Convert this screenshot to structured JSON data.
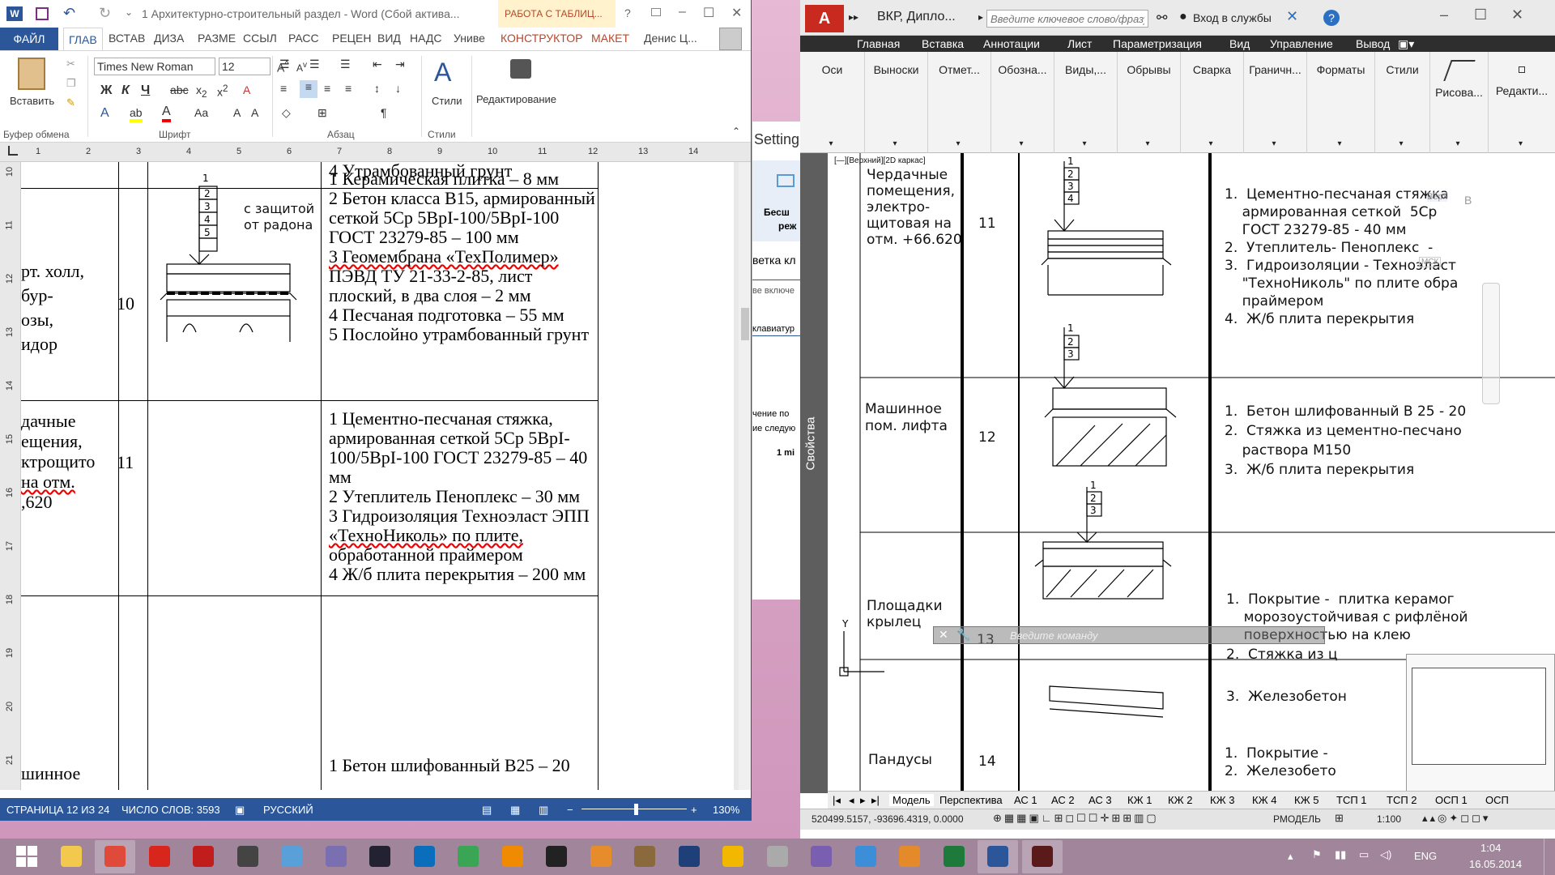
{
  "word": {
    "title": "1 Архитектурно-строительный раздел - Word (Сбой актива...",
    "context_tab": "РАБОТА С ТАБЛИЦ...",
    "window_controls": [
      "?",
      "–",
      "☐",
      "✕"
    ],
    "tabs": [
      "ФАЙЛ",
      "ГЛАВ",
      "ВСТАВ",
      "ДИЗА",
      "РАЗМЕ",
      "ССЫЛ",
      "РАСС",
      "РЕЦЕН",
      "ВИД",
      "НАДС",
      "Униве",
      "КОНСТРУКТОР",
      "МАКЕТ"
    ],
    "user": "Денис Ц...",
    "ribbon": {
      "paste": "Вставить",
      "font_name": "Times New Roman",
      "font_size": "12",
      "styles": "Стили",
      "editing": "Редактирование",
      "groups": [
        "Буфер обмена",
        "Шрифт",
        "Абзац",
        "Стили"
      ]
    },
    "ruler_numbers": [
      "1",
      "2",
      "3",
      "4",
      "5",
      "6",
      "7",
      "8",
      "9",
      "10",
      "11",
      "12",
      "13",
      "14"
    ],
    "vruler_numbers": [
      "10",
      "11",
      "12",
      "13",
      "14",
      "15",
      "16",
      "17",
      "18",
      "19",
      "20",
      "21"
    ],
    "doc": {
      "row0_text": "4 Утрамбованный грунт",
      "row1": {
        "room": [
          "рт. холл,",
          "бур-",
          "озы,",
          "идор"
        ],
        "num": "10",
        "note": [
          "с защитой",
          "от радона"
        ],
        "layers": [
          "1",
          "2",
          "3",
          "4",
          "5"
        ],
        "desc": [
          "1 Керамическая плитка – 8 мм",
          "2 Бетон класса В15, армированный",
          "сеткой 5Ср 5ВрI-100/5ВрI-100",
          "ГОСТ 23279-85 – 100 мм",
          "3 Геомембрана «ТехПолимер»",
          "ПЭВД ТУ 21-33-2-85, лист",
          "плоский, в два слоя – 2 мм",
          "4 Песчаная подготовка – 55 мм",
          "5 Послойно утрамбованный грунт"
        ]
      },
      "row2": {
        "room": [
          "дачные",
          "ещения,",
          "ктрощито",
          "на отм.",
          ",620"
        ],
        "num": "11",
        "desc": [
          "1 Цементно-песчаная стяжка,",
          "армированная сеткой 5Ср 5ВрI-",
          "100/5ВрI-100 ГОСТ 23279-85 – 40",
          "мм",
          "2 Утеплитель Пеноплекс – 30 мм",
          "3 Гидроизоляция Техноэласт ЭПП",
          "«ТехноНиколь» по плите,",
          "обработанной праймером",
          "4 Ж/б плита перекрытия – 200 мм"
        ]
      },
      "row3": {
        "room": [
          "шинное"
        ],
        "desc": [
          "1 Бетон шлифованный В25 – 20"
        ]
      }
    },
    "status": {
      "page": "СТРАНИЦА 12 ИЗ 24",
      "words": "ЧИСЛО СЛОВ: 3593",
      "lang": "РУССКИЙ",
      "zoom": "130%"
    }
  },
  "background_window": {
    "settings": "Setting",
    "items": [
      "Бесш",
      "реж",
      "ветка кл",
      "ве включе",
      "клавиатур",
      "чение по",
      "ие следую",
      "1 mi"
    ]
  },
  "autocad": {
    "title": "ВКР, Дипло...",
    "search_placeholder": "Введите ключевое слово/фразу",
    "login": "Вход в службы",
    "menu": [
      "Главная",
      "Вставка",
      "Аннотации",
      "Лист",
      "Параметризация",
      "Вид",
      "Управление",
      "Вывод"
    ],
    "panels": [
      "Оси",
      "Выноски",
      "Отмет...",
      "Обозна...",
      "Виды,...",
      "Обрывы",
      "Сварка",
      "Граничн...",
      "Форматы",
      "Стили",
      "Рисова...",
      "Редакти..."
    ],
    "viewport_label": "[—][Верхний][2D каркас]",
    "properties_label": "Свойства",
    "rows": [
      {
        "room": [
          "Чердачные",
          "помещения,",
          "электро-",
          "щитовая на",
          "отм. +66.620"
        ],
        "num": "11",
        "layers": [
          "1",
          "2",
          "3",
          "4"
        ],
        "desc": [
          "1.  Цементно-песчаная стяжка",
          "    армированная сеткой  5Ср",
          "    ГОСТ 23279-85 - 40 мм",
          "2.  Утеплитель- Пеноплекс  -",
          "3.  Гидроизоляции - Техноэласт",
          "    \"ТехноНиколь\" по плите обра",
          "    праймером",
          "4.  Ж/б плита перекрытия"
        ]
      },
      {
        "room": [
          "Машинное",
          "пом. лифта"
        ],
        "num": "12",
        "layers": [
          "1",
          "2",
          "3"
        ],
        "desc": [
          "1.  Бетон шлифованный В 25 - 20",
          "2.  Стяжка из цементно-песчано",
          "    раствора М150",
          "3.  Ж/б плита перекрытия"
        ]
      },
      {
        "room": [
          "Площадки",
          "крылец"
        ],
        "num": "13",
        "layers": [
          "1",
          "2",
          "3"
        ],
        "desc": [
          "1.  Покрытие -  плитка керамог",
          "    морозоустойчивая с рифлёной",
          "    поверхностью на клею",
          "2.  Стяжка из ц",
          "",
          "3.  Железобетон"
        ]
      },
      {
        "room": [
          "Пандусы"
        ],
        "num": "14",
        "desc": [
          "1.  Покрытие -",
          "2.  Железобето"
        ]
      }
    ],
    "command_placeholder": "Введите команду",
    "tabs": [
      "Модель",
      "Перспектива",
      "АС 1",
      "АС 2",
      "АС 3",
      "КЖ 1",
      "КЖ 2",
      "КЖ 3",
      "КЖ 4",
      "КЖ 5",
      "ТСП 1",
      "ТСП 2",
      "ОСП 1",
      "ОСП"
    ],
    "coords": "520499.5157, -93696.4319, 0.0000",
    "model_label": "РМОДЕЛЬ",
    "scale": "1:100",
    "ghost_labels": [
      "Верх",
      "В",
      "МСК"
    ]
  },
  "taskbar": {
    "apps": [
      "windows-start",
      "file-explorer",
      "chrome",
      "acrobat",
      "acrobat-reader",
      "autocad-old",
      "sketchup",
      "winrar",
      "steam",
      "outlook",
      "sync",
      "vlc",
      "app-panda",
      "office-picture",
      "gimp",
      "photoshop",
      "app-tool",
      "app-gray",
      "app-arc",
      "itunes",
      "messenger",
      "excel",
      "word",
      "autocad"
    ],
    "lang": "ENG",
    "time": "1:04",
    "date": "16.05.2014"
  }
}
